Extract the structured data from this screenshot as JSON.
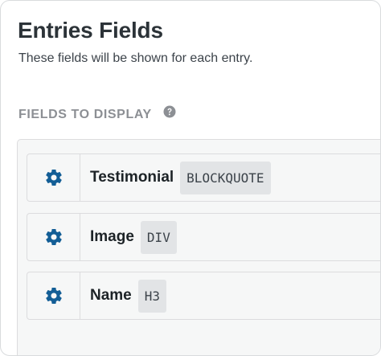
{
  "header": {
    "title": "Entries Fields",
    "description": "These fields will be shown for each entry."
  },
  "section": {
    "label": "FIELDS TO DISPLAY",
    "help_icon": "question-circle-icon"
  },
  "fields": [
    {
      "name": "Testimonial",
      "tag": "BLOCKQUOTE",
      "icon": "gear-icon"
    },
    {
      "name": "Image",
      "tag": "DIV",
      "icon": "gear-icon"
    },
    {
      "name": "Name",
      "tag": "H3",
      "icon": "gear-icon"
    }
  ],
  "colors": {
    "accent": "#135e96",
    "title": "#2c3338",
    "section_label": "#8c8f94",
    "panel_bg": "#f6f7f7",
    "badge_bg": "#e2e4e6"
  }
}
